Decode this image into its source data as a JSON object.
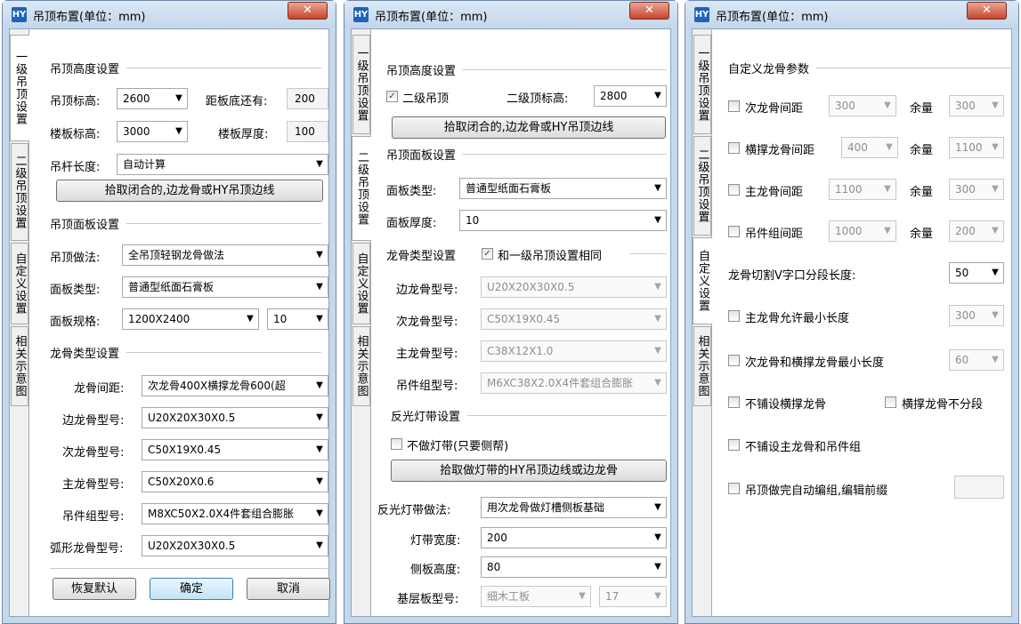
{
  "window_title": "吊顶布置(单位：mm)",
  "app_icon": "HY",
  "close_glyph": "✕",
  "arrow": "▼",
  "check": "✓",
  "tabs": {
    "t1": "一级吊顶设置",
    "t2": "二级吊顶设置",
    "t3": "自定义设置",
    "t4": "相关示意图"
  },
  "w1": {
    "g_height": "吊顶高度设置",
    "ceiling_h_label": "吊顶标高:",
    "ceiling_h": "2600",
    "remain_label": "距板底还有:",
    "remain": "200",
    "floor_h_label": "楼板标高:",
    "floor_h": "3000",
    "thick_label": "楼板厚度:",
    "thick": "100",
    "rod_label": "吊杆长度:",
    "rod": "自动计算",
    "pick": "拾取闭合的,边龙骨或HY吊顶边线",
    "g_panel": "吊顶面板设置",
    "method_label": "吊顶做法:",
    "method": "全吊顶轻钢龙骨做法",
    "ptype_label": "面板类型:",
    "ptype": "普通型纸面石膏板",
    "pspec_label": "面板规格:",
    "pspec": "1200X2400",
    "pspec2": "10",
    "g_keel": "龙骨类型设置",
    "spacing_label": "龙骨间距:",
    "spacing": "次龙骨400X横撑龙骨600(超",
    "edge_label": "边龙骨型号:",
    "edge": "U20X20X30X0.5",
    "sec_label": "次龙骨型号:",
    "sec": "C50X19X0.45",
    "main_label": "主龙骨型号:",
    "main": "C50X20X0.6",
    "hang_label": "吊件组型号:",
    "hang": "M8XC50X2.0X4件套组合膨胀",
    "arc_label": "弧形龙骨型号:",
    "arc": "U20X20X30X0.5",
    "reset": "恢复默认",
    "ok": "确定",
    "cancel": "取消"
  },
  "w2": {
    "g_height": "吊顶高度设置",
    "second_cb": "二级吊顶",
    "second_h_label": "二级顶标高:",
    "second_h": "2800",
    "pick": "拾取闭合的,边龙骨或HY吊顶边线",
    "g_panel": "吊顶面板设置",
    "ptype_label": "面板类型:",
    "ptype": "普通型纸面石膏板",
    "pthick_label": "面板厚度:",
    "pthick": "10",
    "keel_label": "龙骨类型设置",
    "same_cb": "和一级吊顶设置相同",
    "edge_label": "边龙骨型号:",
    "edge": "U20X20X30X0.5",
    "sec_label": "次龙骨型号:",
    "sec": "C50X19X0.45",
    "main_label": "主龙骨型号:",
    "main": "C38X12X1.0",
    "hang_label": "吊件组型号:",
    "hang": "M6XC38X2.0X4件套组合膨胀",
    "g_light": "反光灯带设置",
    "nolight_cb": "不做灯带(只要侧帮)",
    "pick_light": "拾取做灯带的HY吊顶边线或边龙骨",
    "light_method_label": "反光灯带做法:",
    "light_method": "用次龙骨做灯槽侧板基础",
    "band_w_label": "灯带宽度:",
    "band_w": "200",
    "side_h_label": "侧板高度:",
    "side_h": "80",
    "base_label": "基层板型号:",
    "base": "细木工板",
    "base2": "17"
  },
  "w3": {
    "g_custom": "自定义龙骨参数",
    "r1": {
      "label": "次龙骨间距",
      "val": "300",
      "rem_label": "余量",
      "rem": "300"
    },
    "r2": {
      "label": "横撑龙骨间距",
      "val": "400",
      "rem_label": "余量",
      "rem": "1100"
    },
    "r3": {
      "label": "主龙骨间距",
      "val": "1100",
      "rem_label": "余量",
      "rem": "300"
    },
    "r4": {
      "label": "吊件组间距",
      "val": "1000",
      "rem_label": "余量",
      "rem": "200"
    },
    "vcut_label": "龙骨切割V字口分段长度:",
    "vcut": "50",
    "min_main_cb": "主龙骨允许最小长度",
    "min_main": "300",
    "min_sec_cb": "次龙骨和横撑龙骨最小长度",
    "min_sec": "60",
    "no_cross_cb": "不铺设横撑龙骨",
    "no_seg_cb": "横撑龙骨不分段",
    "no_main_cb": "不铺设主龙骨和吊件组",
    "auto_group_cb": "吊顶做完自动编组,编辑前缀"
  }
}
